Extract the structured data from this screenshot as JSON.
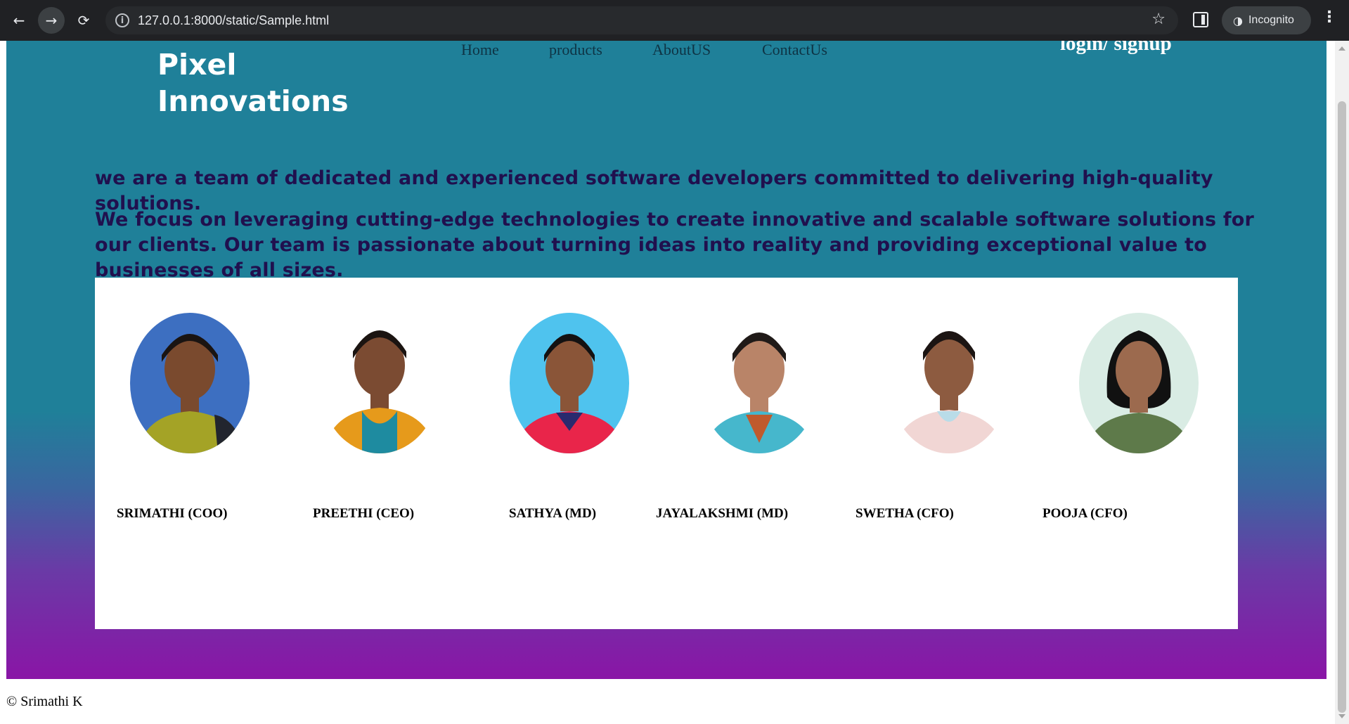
{
  "browser": {
    "back_icon": "←",
    "forward_icon": "→",
    "reload_icon": "⟳",
    "info_icon": "i",
    "url": "127.0.0.1:8000/static/Sample.html",
    "star_icon": "☆",
    "incognito_icon": "◑",
    "incognito_label": "Incognito",
    "menu_icon": "⋮"
  },
  "site": {
    "logo_line1": "Pixel",
    "logo_line2": "Innovations",
    "nav": [
      "Home",
      "products",
      "AboutUS",
      "ContactUs"
    ],
    "login_label": "login/ signup",
    "intro_p1": "we are a team of dedicated and experienced software developers committed to delivering high-quality solutions.",
    "intro_p2": "We focus on leveraging cutting-edge technologies to create innovative and scalable software solutions for our clients. Our team is passionate about turning ideas into reality and providing exceptional value to businesses of all sizes.",
    "team": [
      {
        "name": "SRIMATHI (COO)"
      },
      {
        "name": "PREETHI (CEO)"
      },
      {
        "name": "SATHYA (MD)"
      },
      {
        "name": "JAYALAKSHMI (MD)"
      },
      {
        "name": "SWETHA (CFO)"
      },
      {
        "name": "POOJA (CFO)"
      }
    ],
    "footer": "© Srimathi K"
  },
  "colors": {
    "header_teal": "#1f8099",
    "gradient_bottom": "#8a15a6",
    "intro_text": "#20104e",
    "nav_text": "#0e3344"
  }
}
